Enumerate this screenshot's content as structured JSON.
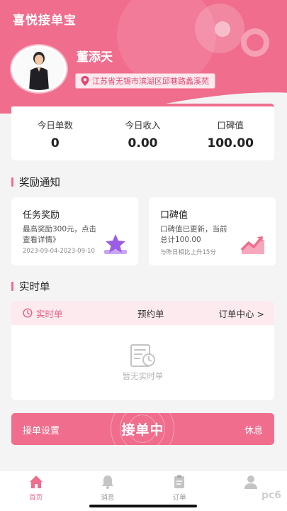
{
  "app": {
    "title": "喜悦接单宝"
  },
  "profile": {
    "name": "董添天",
    "location": "江苏省无锡市滨湖区邱巷路蠡溪苑"
  },
  "stats": [
    {
      "label": "今日单数",
      "value": "0"
    },
    {
      "label": "今日收入",
      "value": "0.00"
    },
    {
      "label": "口碑值",
      "value": "100.00"
    }
  ],
  "rewards": {
    "title": "奖励通知",
    "task": {
      "title": "任务奖励",
      "desc": "最高奖励300元，点击查看详情》",
      "meta": "2023-09-04-2023-09-10"
    },
    "reputation": {
      "title": "口碑值",
      "desc": "口碑值已更新，当前总计100.00",
      "meta": "与昨日相比上升15分"
    }
  },
  "orders": {
    "title": "实时单",
    "tab_realtime": "实时单",
    "tab_preorder": "预约单",
    "tab_center": "订单中心 >",
    "empty_text": "暂无实时单"
  },
  "action": {
    "settings": "接单设置",
    "accepting": "接单中",
    "rest": "休息"
  },
  "nav": [
    {
      "label": "首页",
      "icon": "home-icon",
      "active": true
    },
    {
      "label": "消息",
      "icon": "bell-icon",
      "active": false
    },
    {
      "label": "订单",
      "icon": "clipboard-icon",
      "active": false
    },
    {
      "label": "",
      "icon": "user-icon",
      "active": false
    }
  ],
  "watermark": "pc6",
  "colors": {
    "accent": "#f06d8d",
    "accent_light": "#fdeaee",
    "purple": "#9b5de5"
  }
}
